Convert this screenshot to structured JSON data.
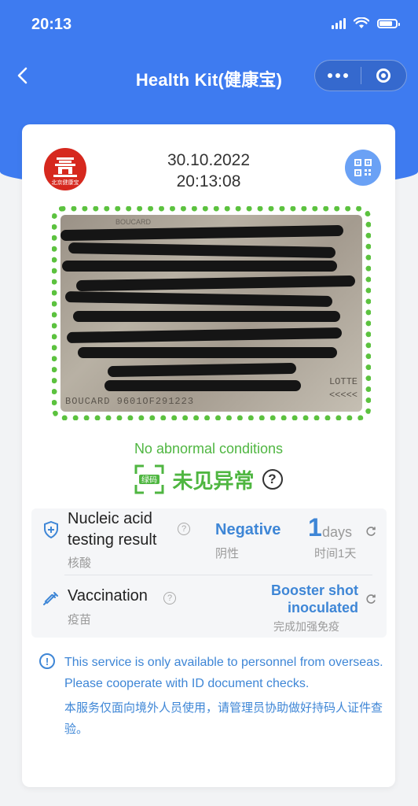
{
  "status_bar": {
    "time": "20:13"
  },
  "nav": {
    "title": "Health Kit(健康宝)"
  },
  "card": {
    "date": "30.10.2022",
    "time": "20:13:08",
    "document_text_fragments": [
      "BOUCARD",
      "LOTTE",
      "<<<<<",
      "9601OF291223"
    ],
    "status_en": "No abnormal conditions",
    "status_cn": "未见异常",
    "code_badge": "绿码",
    "logo_text": "北京健康宝",
    "nucleic": {
      "label_en": "Nucleic acid testing result",
      "label_cn": "核酸",
      "result": "Negative",
      "result_cn": "阴性",
      "days_num": "1",
      "days_unit": "days",
      "days_cn": "时间1天"
    },
    "vaccination": {
      "label_en": "Vaccination",
      "label_cn": "疫苗",
      "status_line1": "Booster shot",
      "status_line2": "inoculated",
      "status_cn": "完成加强免疫"
    },
    "notice_en": "This service is only available to personnel from overseas. Please cooperate with ID document checks.",
    "notice_cn": "本服务仅面向境外人员使用，请管理员协助做好持码人证件查验。"
  },
  "colors": {
    "brand_blue": "#3e7bf0",
    "green": "#4fb641",
    "link_blue": "#3e86d6"
  }
}
